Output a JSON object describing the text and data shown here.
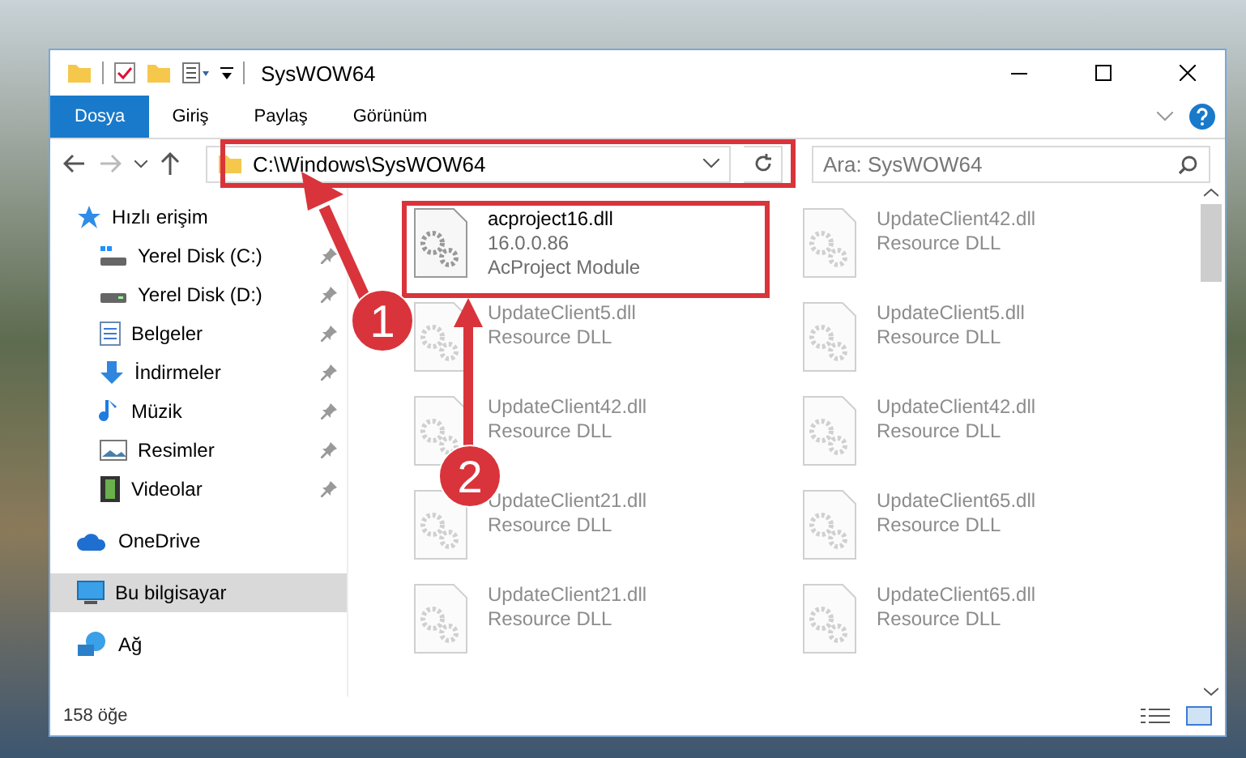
{
  "window": {
    "title": "SysWOW64"
  },
  "ribbon_tabs": [
    {
      "label": "Dosya",
      "selected": true
    },
    {
      "label": "Giriş",
      "selected": false
    },
    {
      "label": "Paylaş",
      "selected": false
    },
    {
      "label": "Görünüm",
      "selected": false
    }
  ],
  "address": {
    "path": "C:\\Windows\\SysWOW64"
  },
  "search": {
    "placeholder": "Ara: SysWOW64"
  },
  "sidebar": {
    "items": [
      {
        "label": "Hızlı erişim",
        "kind": "star",
        "selected": false,
        "children": [
          {
            "label": "Yerel Disk (C:)",
            "kind": "system-drive",
            "pinned": true,
            "selected": false
          },
          {
            "label": "Yerel Disk (D:)",
            "kind": "drive",
            "pinned": true,
            "selected": false
          },
          {
            "label": "Belgeler",
            "kind": "document",
            "pinned": true,
            "selected": false
          },
          {
            "label": "İndirmeler",
            "kind": "download",
            "pinned": true,
            "selected": false
          },
          {
            "label": "Müzik",
            "kind": "music",
            "pinned": true,
            "selected": false
          },
          {
            "label": "Resimler",
            "kind": "picture",
            "pinned": true,
            "selected": false
          },
          {
            "label": "Videolar",
            "kind": "video",
            "pinned": true,
            "selected": false
          }
        ]
      },
      {
        "label": "OneDrive",
        "kind": "cloud",
        "selected": false
      },
      {
        "label": "Bu bilgisayar",
        "kind": "computer",
        "selected": true
      },
      {
        "label": "Ağ",
        "kind": "network",
        "selected": false
      }
    ]
  },
  "files": [
    {
      "name": "acproject16.dll",
      "details": [
        "16.0.0.86",
        "AcProject Module"
      ],
      "blurred": false
    },
    {
      "name": "UpdateClient42.dll",
      "details": [
        "Resource DLL"
      ],
      "blurred": true
    },
    {
      "name": "UpdateClient5.dll",
      "details": [
        "Resource DLL"
      ],
      "blurred": true
    },
    {
      "name": "UpdateClient5.dll",
      "details": [
        "Resource DLL"
      ],
      "blurred": true
    },
    {
      "name": "UpdateClient42.dll",
      "details": [
        "Resource DLL"
      ],
      "blurred": true
    },
    {
      "name": "UpdateClient42.dll",
      "details": [
        "Resource DLL"
      ],
      "blurred": true
    },
    {
      "name": "UpdateClient21.dll",
      "details": [
        "Resource DLL"
      ],
      "blurred": true
    },
    {
      "name": "UpdateClient65.dll",
      "details": [
        "Resource DLL"
      ],
      "blurred": true
    },
    {
      "name": "UpdateClient21.dll",
      "details": [
        "Resource DLL"
      ],
      "blurred": true
    },
    {
      "name": "UpdateClient65.dll",
      "details": [
        "Resource DLL"
      ],
      "blurred": true
    }
  ],
  "status_bar": {
    "count": "158 öğe"
  },
  "annotations": [
    {
      "label": "1"
    },
    {
      "label": "2"
    }
  ]
}
